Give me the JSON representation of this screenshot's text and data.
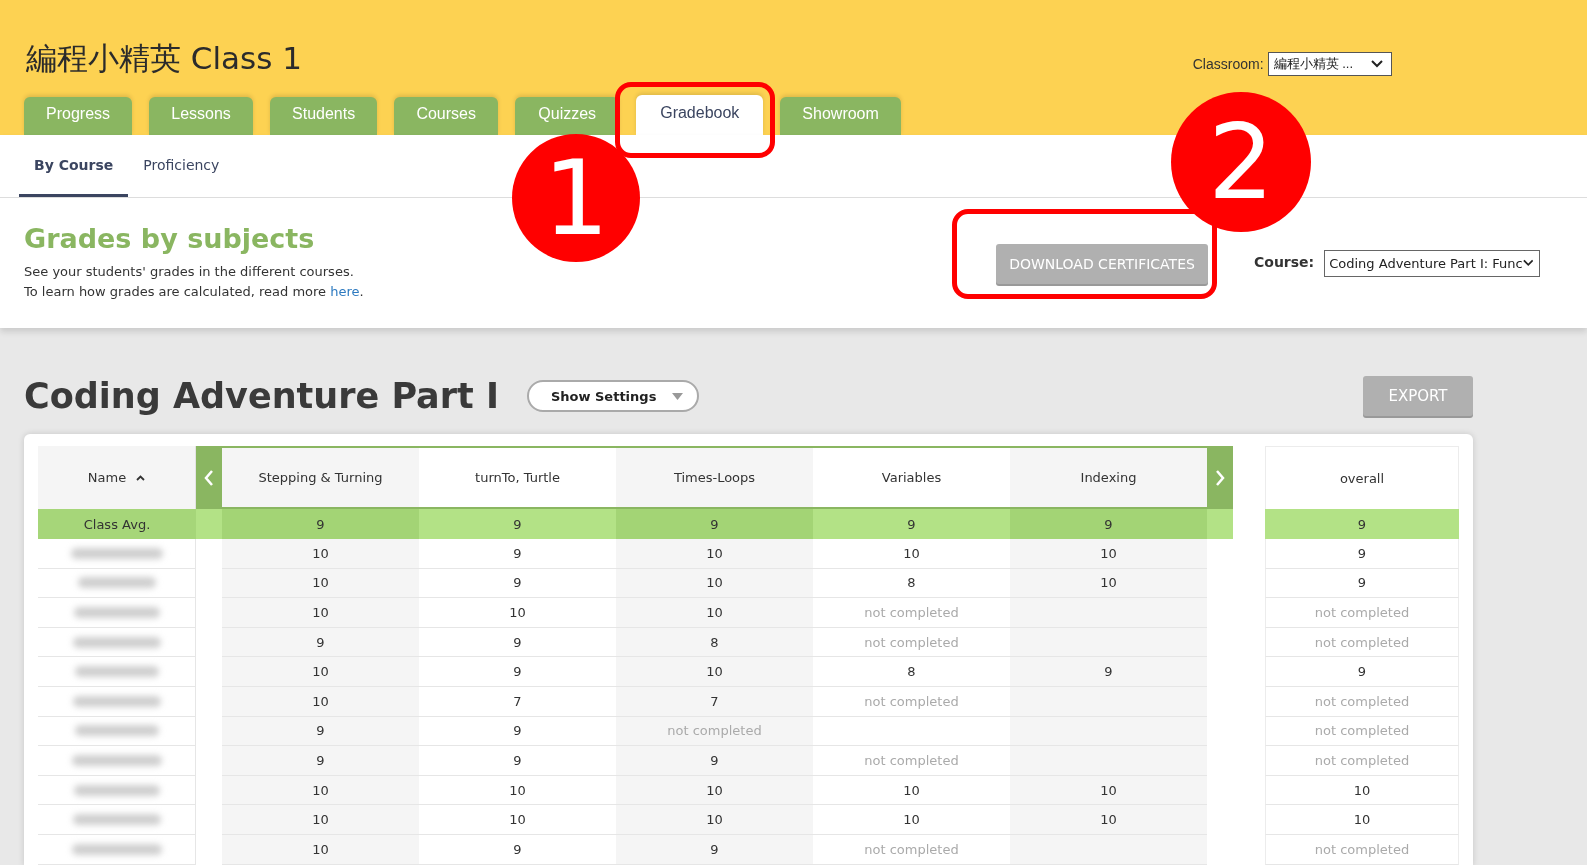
{
  "header": {
    "title": "編程小精英 Class 1",
    "classroom_label": "Classroom:",
    "classroom_value": "編程小精英 ..."
  },
  "tabs": [
    {
      "label": "Progress",
      "selected": false
    },
    {
      "label": "Lessons",
      "selected": false
    },
    {
      "label": "Students",
      "selected": false
    },
    {
      "label": "Courses",
      "selected": false
    },
    {
      "label": "Quizzes",
      "selected": false
    },
    {
      "label": "Gradebook",
      "selected": true
    },
    {
      "label": "Showroom",
      "selected": false
    }
  ],
  "subtabs": [
    {
      "label": "By Course",
      "selected": true
    },
    {
      "label": "Proficiency",
      "selected": false
    }
  ],
  "intro": {
    "heading": "Grades by subjects",
    "line1": "See your students' grades in the different courses.",
    "line2": "To learn how grades are calculated, read more ",
    "link": "here",
    "line2_end": ".",
    "download_button": "DOWNLOAD CERTIFICATES",
    "course_label": "Course:",
    "course_value": "Coding Adventure Part I: Func"
  },
  "course": {
    "title": "Coding Adventure Part I",
    "settings_button": "Show Settings",
    "export_button": "EXPORT"
  },
  "table": {
    "name_column": "Name",
    "columns": [
      "Stepping & Turning",
      "turnTo, Turtle",
      "Times-Loops",
      "Variables",
      "Indexing"
    ],
    "overall_column": "overall",
    "average": {
      "label": "Class Avg.",
      "grades": [
        "9",
        "9",
        "9",
        "9",
        "9"
      ],
      "overall": "9"
    },
    "rows": [
      {
        "grades": [
          {
            "text": "10",
            "completed": true
          },
          {
            "text": "9",
            "completed": true
          },
          {
            "text": "10",
            "completed": true
          },
          {
            "text": "10",
            "completed": true
          },
          {
            "text": "10",
            "completed": true
          }
        ],
        "overall": {
          "text": "9",
          "completed": true
        }
      },
      {
        "grades": [
          {
            "text": "10",
            "completed": true
          },
          {
            "text": "9",
            "completed": true
          },
          {
            "text": "10",
            "completed": true
          },
          {
            "text": "8",
            "completed": true
          },
          {
            "text": "10",
            "completed": true
          }
        ],
        "overall": {
          "text": "9",
          "completed": true
        }
      },
      {
        "grades": [
          {
            "text": "10",
            "completed": true
          },
          {
            "text": "10",
            "completed": true
          },
          {
            "text": "10",
            "completed": true
          },
          {
            "text": "not completed",
            "completed": false
          }
        ],
        "overall": {
          "text": "not completed",
          "completed": false
        }
      },
      {
        "grades": [
          {
            "text": "9",
            "completed": true
          },
          {
            "text": "9",
            "completed": true
          },
          {
            "text": "8",
            "completed": true
          },
          {
            "text": "not completed",
            "completed": false
          }
        ],
        "overall": {
          "text": "not completed",
          "completed": false
        }
      },
      {
        "grades": [
          {
            "text": "10",
            "completed": true
          },
          {
            "text": "9",
            "completed": true
          },
          {
            "text": "10",
            "completed": true
          },
          {
            "text": "8",
            "completed": true
          },
          {
            "text": "9",
            "completed": true
          }
        ],
        "overall": {
          "text": "9",
          "completed": true
        }
      },
      {
        "grades": [
          {
            "text": "10",
            "completed": true
          },
          {
            "text": "7",
            "completed": true
          },
          {
            "text": "7",
            "completed": true
          },
          {
            "text": "not completed",
            "completed": false
          }
        ],
        "overall": {
          "text": "not completed",
          "completed": false
        }
      },
      {
        "grades": [
          {
            "text": "9",
            "completed": true
          },
          {
            "text": "9",
            "completed": true
          },
          {
            "text": "not completed",
            "completed": false
          }
        ],
        "overall": {
          "text": "not completed",
          "completed": false
        }
      },
      {
        "grades": [
          {
            "text": "9",
            "completed": true
          },
          {
            "text": "9",
            "completed": true
          },
          {
            "text": "9",
            "completed": true
          },
          {
            "text": "not completed",
            "completed": false
          }
        ],
        "overall": {
          "text": "not completed",
          "completed": false
        }
      },
      {
        "grades": [
          {
            "text": "10",
            "completed": true
          },
          {
            "text": "10",
            "completed": true
          },
          {
            "text": "10",
            "completed": true
          },
          {
            "text": "10",
            "completed": true
          },
          {
            "text": "10",
            "completed": true
          }
        ],
        "overall": {
          "text": "10",
          "completed": true
        }
      },
      {
        "grades": [
          {
            "text": "10",
            "completed": true
          },
          {
            "text": "10",
            "completed": true
          },
          {
            "text": "10",
            "completed": true
          },
          {
            "text": "10",
            "completed": true
          },
          {
            "text": "10",
            "completed": true
          }
        ],
        "overall": {
          "text": "10",
          "completed": true
        }
      },
      {
        "grades": [
          {
            "text": "10",
            "completed": true
          },
          {
            "text": "9",
            "completed": true
          },
          {
            "text": "9",
            "completed": true
          },
          {
            "text": "not completed",
            "completed": false
          }
        ],
        "overall": {
          "text": "not completed",
          "completed": false
        }
      }
    ]
  },
  "annotations": [
    {
      "number": "1"
    },
    {
      "number": "2"
    }
  ]
}
